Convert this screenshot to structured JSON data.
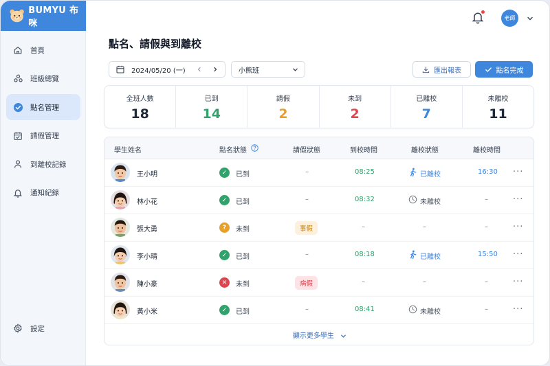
{
  "brand": {
    "name": "BUMYU 布咪"
  },
  "sidebar": {
    "items": [
      {
        "label": "首頁",
        "icon": "home-icon"
      },
      {
        "label": "班級總覽",
        "icon": "group-icon"
      },
      {
        "label": "點名管理",
        "icon": "check-circle-icon",
        "active": true
      },
      {
        "label": "請假管理",
        "icon": "calendar-check-icon"
      },
      {
        "label": "到離校記錄",
        "icon": "person-icon"
      },
      {
        "label": "通知紀錄",
        "icon": "bell-icon"
      }
    ],
    "settings_label": "設定"
  },
  "header": {
    "user_label": "老師",
    "has_notification": true
  },
  "page": {
    "title": "點名、請假與到離校"
  },
  "toolbar": {
    "date": "2024/05/20 (一)",
    "class_name": "小熊班",
    "export_label": "匯出報表",
    "done_label": "點名完成"
  },
  "colors": {
    "accent": "#3f86dd",
    "present": "#2fa36b",
    "leave": "#e8a02a",
    "absent": "#e0454f",
    "left": "#3f86dd"
  },
  "stats": [
    {
      "label": "全班人數",
      "value": "18",
      "color": "#1f2937"
    },
    {
      "label": "已到",
      "value": "14",
      "color": "#2fa36b"
    },
    {
      "label": "請假",
      "value": "2",
      "color": "#e8a02a"
    },
    {
      "label": "未到",
      "value": "2",
      "color": "#e0454f"
    },
    {
      "label": "已離校",
      "value": "7",
      "color": "#3f86dd"
    },
    {
      "label": "未離校",
      "value": "11",
      "color": "#1f2937"
    }
  ],
  "table": {
    "headers": [
      "學生姓名",
      "點名狀態",
      "請假狀態",
      "到校時間",
      "離校狀態",
      "離校時間"
    ],
    "rows": [
      {
        "name": "王小明",
        "status": "已到",
        "status_type": "present",
        "leave": "–",
        "arrive": "08:25",
        "depart_status": "已離校",
        "depart_type": "left",
        "depart_time": "16:30"
      },
      {
        "name": "林小花",
        "status": "已到",
        "status_type": "present",
        "leave": "–",
        "arrive": "08:32",
        "depart_status": "未離校",
        "depart_type": "not-left",
        "depart_time": "–"
      },
      {
        "name": "張大勇",
        "status": "未到",
        "status_type": "leave",
        "leave": "事假",
        "leave_type": "personal",
        "arrive": "–",
        "depart_status": "–",
        "depart_type": "none",
        "depart_time": "–"
      },
      {
        "name": "李小晴",
        "status": "已到",
        "status_type": "present",
        "leave": "–",
        "arrive": "08:18",
        "depart_status": "已離校",
        "depart_type": "left",
        "depart_time": "15:50"
      },
      {
        "name": "陳小豪",
        "status": "未到",
        "status_type": "absent",
        "leave": "病假",
        "leave_type": "sick",
        "arrive": "–",
        "depart_status": "–",
        "depart_type": "none",
        "depart_time": "–"
      },
      {
        "name": "黃小米",
        "status": "已到",
        "status_type": "present",
        "leave": "–",
        "arrive": "08:41",
        "depart_status": "未離校",
        "depart_type": "not-left",
        "depart_time": "–"
      }
    ],
    "show_more_label": "顯示更多學生"
  }
}
